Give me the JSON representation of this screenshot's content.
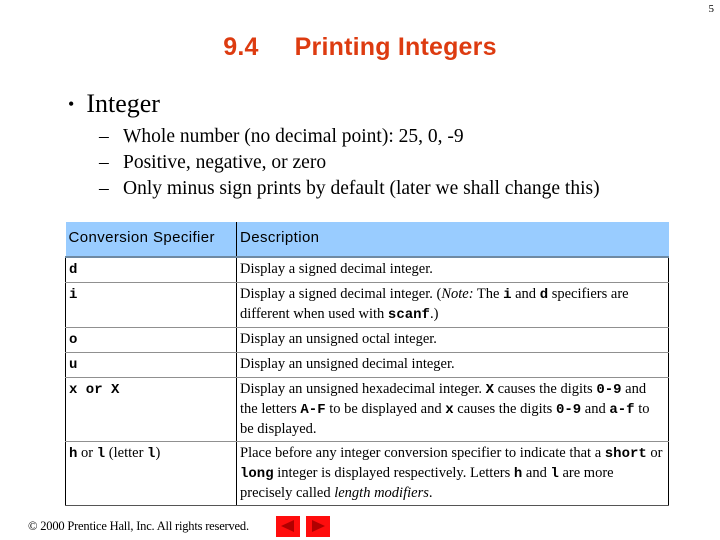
{
  "page_number": "5",
  "title": {
    "number": "9.4",
    "text": "Printing Integers"
  },
  "bullets": {
    "main": "Integer",
    "subs": [
      "Whole number (no decimal point):  25, 0, -9",
      "Positive, negative, or zero",
      "Only minus sign prints by default (later we shall change this)"
    ]
  },
  "table": {
    "headers": [
      "Conversion Specifier",
      "Description"
    ],
    "rows": [
      {
        "spec": [
          {
            "t": "d",
            "m": true
          }
        ],
        "desc": [
          {
            "t": "Display a signed decimal integer."
          }
        ]
      },
      {
        "spec": [
          {
            "t": "i",
            "m": true
          }
        ],
        "desc": [
          {
            "t": "Display a signed decimal integer. ("
          },
          {
            "t": "Note:",
            "i": true
          },
          {
            "t": " The "
          },
          {
            "t": "i",
            "m": true
          },
          {
            "t": " and "
          },
          {
            "t": "d",
            "m": true
          },
          {
            "t": " specifiers are different when used with "
          },
          {
            "t": "scanf",
            "m": true
          },
          {
            "t": ".)"
          }
        ]
      },
      {
        "spec": [
          {
            "t": "o",
            "m": true
          }
        ],
        "desc": [
          {
            "t": "Display an unsigned octal integer."
          }
        ]
      },
      {
        "spec": [
          {
            "t": "u",
            "m": true
          }
        ],
        "desc": [
          {
            "t": "Display an unsigned decimal integer."
          }
        ]
      },
      {
        "spec": [
          {
            "t": "x or X",
            "m": true
          }
        ],
        "desc": [
          {
            "t": "Display an unsigned hexadecimal integer. "
          },
          {
            "t": "X",
            "m": true
          },
          {
            "t": " causes the digits "
          },
          {
            "t": "0-9",
            "m": true
          },
          {
            "t": " and the letters "
          },
          {
            "t": "A-F",
            "m": true
          },
          {
            "t": " to be displayed and "
          },
          {
            "t": "x",
            "m": true
          },
          {
            "t": " causes the digits "
          },
          {
            "t": "0-9",
            "m": true
          },
          {
            "t": " and "
          },
          {
            "t": "a-f",
            "m": true
          },
          {
            "t": "  to be displayed."
          }
        ]
      },
      {
        "spec": [
          {
            "t": "h",
            "m": true
          },
          {
            "t": " or "
          },
          {
            "t": "l",
            "m": true
          },
          {
            "t": " (letter "
          },
          {
            "t": "l",
            "m": true
          },
          {
            "t": ")"
          }
        ],
        "desc": [
          {
            "t": "Place before any integer conversion specifier to indicate that a "
          },
          {
            "t": "short",
            "m": true
          },
          {
            "t": " or "
          },
          {
            "t": "long",
            "m": true
          },
          {
            "t": " integer is displayed respectively. Letters "
          },
          {
            "t": "h",
            "m": true
          },
          {
            "t": " and "
          },
          {
            "t": "l",
            "m": true
          },
          {
            "t": " are more precisely called "
          },
          {
            "t": "length modifiers",
            "i": true
          },
          {
            "t": "."
          }
        ]
      }
    ]
  },
  "footer": {
    "copyright": "© 2000 Prentice Hall, Inc.  All rights reserved."
  },
  "nav": {
    "prev_icon": "previous-slide-icon",
    "next_icon": "next-slide-icon",
    "button_color": "#ff0d0d",
    "arrow_color": "#b00000"
  },
  "colors": {
    "title": "#dd3b10",
    "table_header": "#99ccff"
  }
}
